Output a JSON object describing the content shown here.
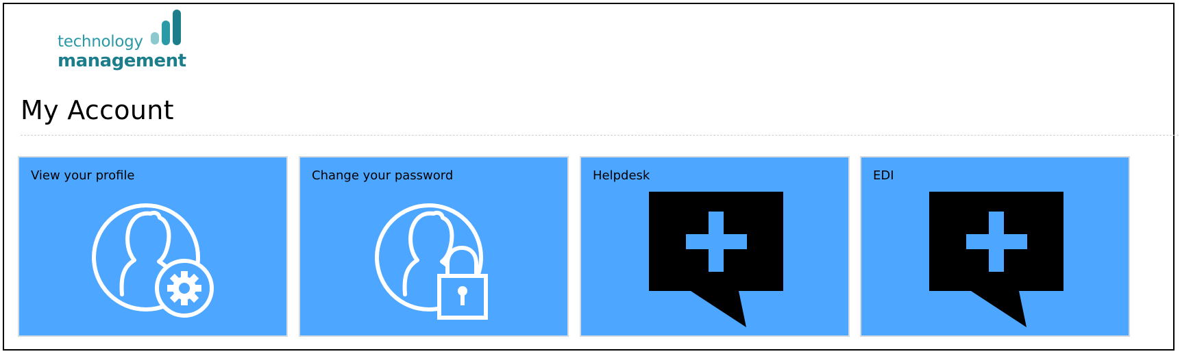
{
  "logo": {
    "line1": "technology",
    "line2": "management",
    "colors": {
      "light": "#2a9aa6",
      "dark": "#1b7e8a",
      "bar_light": "#8cc9cf"
    }
  },
  "page": {
    "title": "My Account"
  },
  "tiles": [
    {
      "label": "View your profile",
      "icon": "user-settings-icon"
    },
    {
      "label": "Change your password",
      "icon": "user-lock-icon"
    },
    {
      "label": "Helpdesk",
      "icon": "speech-bubble-plus-icon"
    },
    {
      "label": "EDI",
      "icon": "speech-bubble-plus-icon"
    }
  ],
  "colors": {
    "tile_background": "#4da6ff",
    "tile_border": "#d5dbe3",
    "icon_stroke": "#ffffff",
    "bubble_fill": "#000000"
  }
}
